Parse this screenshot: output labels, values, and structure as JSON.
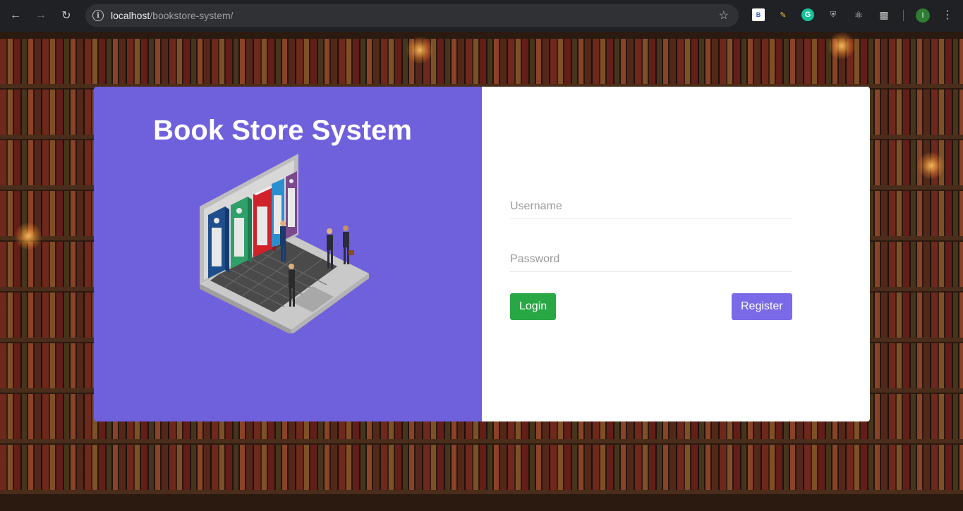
{
  "browser": {
    "url_host": "localhost",
    "url_path": "/bookstore-system/",
    "profile_initial": "I"
  },
  "page": {
    "title": "Book Store System"
  },
  "form": {
    "username_placeholder": "Username",
    "username_value": "",
    "password_placeholder": "Password",
    "password_value": "",
    "login_label": "Login",
    "register_label": "Register"
  },
  "colors": {
    "left_panel": "#6f60dc",
    "login_button": "#28a745",
    "register_button": "#7a6ae8"
  }
}
